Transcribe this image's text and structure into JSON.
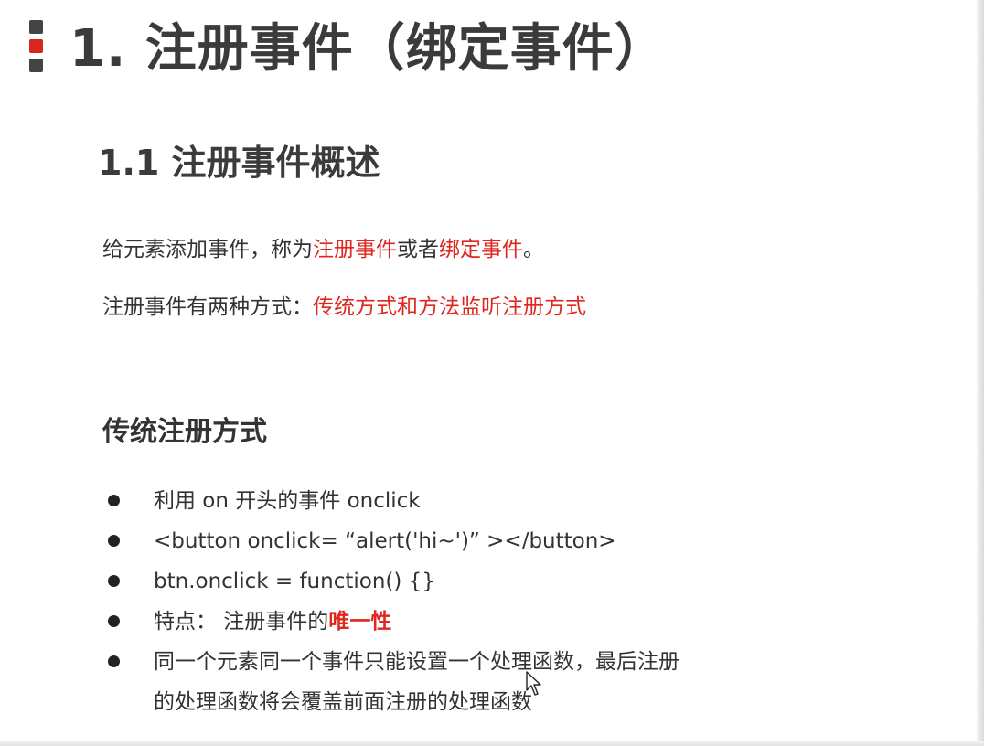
{
  "main_title": "1. 注册事件（绑定事件）",
  "sub_title": "1.1 注册事件概述",
  "intro": {
    "line1": {
      "prefix": "给元素添加事件，称为",
      "highlight1": "注册事件",
      "middle": "或者",
      "highlight2": "绑定事件",
      "suffix": "。"
    },
    "line2": {
      "prefix": "注册事件有两种方式：",
      "highlight": "传统方式和方法监听注册方式"
    }
  },
  "traditional": {
    "heading": "传统注册方式",
    "bullets": [
      "利用 on 开头的事件 onclick",
      "<button onclick= “alert('hi~')” ></button>",
      "btn.onclick = function() {}",
      "特点： 注册事件的",
      "同一个元素同一个事件只能设置一个处理函数，最后注册的处理函数将会覆盖前面注册的处理函数"
    ],
    "uniqueness_emphasis": "唯一性"
  },
  "colors": {
    "accent_red": "#e0261f",
    "text_dark": "#333333",
    "marker_gray": "#444444"
  }
}
